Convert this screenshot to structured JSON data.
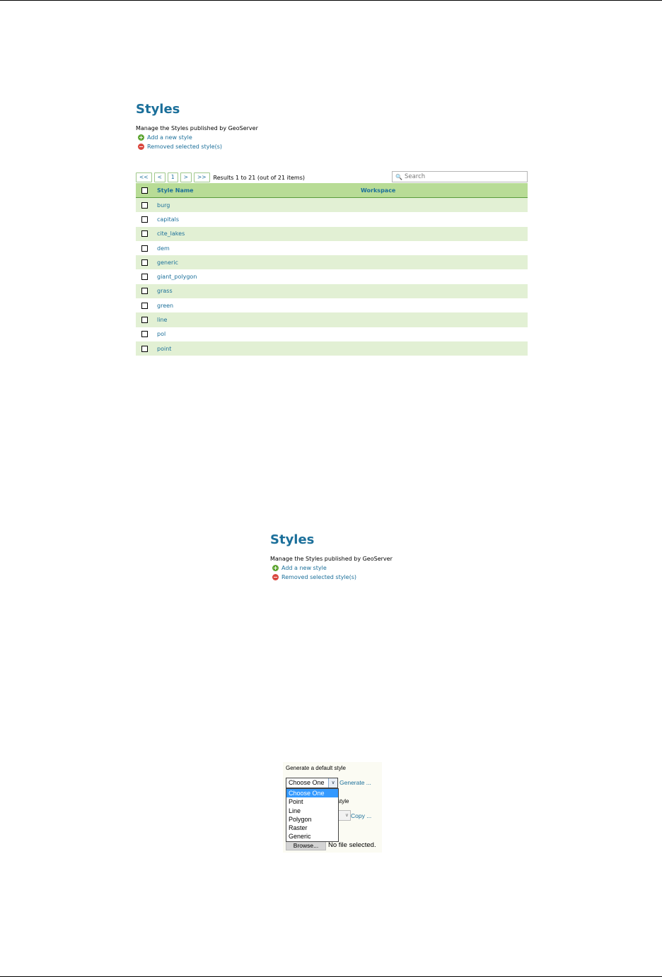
{
  "shot1": {
    "title": "Styles",
    "description": "Manage the Styles published by GeoServer",
    "actions": {
      "add": "Add a new style",
      "remove": "Removed selected style(s)"
    },
    "pager": {
      "first": "<<",
      "prev": "<",
      "page": "1",
      "next": ">",
      "last": ">>",
      "results": "Results 1 to 21 (out of 21 items)"
    },
    "search_placeholder": "Search",
    "columns": {
      "name": "Style Name",
      "workspace": "Workspace"
    },
    "rows": [
      "burg",
      "capitals",
      "cite_lakes",
      "dem",
      "generic",
      "giant_polygon",
      "grass",
      "green",
      "line",
      "pol",
      "point"
    ]
  },
  "shot2": {
    "title": "Styles",
    "description": "Manage the Styles published by GeoServer",
    "actions": {
      "add": "Add a new style",
      "remove": "Removed selected style(s)"
    }
  },
  "shot3": {
    "label": "Generate a default style",
    "selected": "Choose One",
    "generate_link": "Generate ...",
    "obscured_label": "style",
    "copy_link": "Copy ...",
    "options": [
      "Choose One",
      "Point",
      "Line",
      "Polygon",
      "Raster",
      "Generic"
    ],
    "browse": "Browse...",
    "no_file": "No file selected."
  }
}
